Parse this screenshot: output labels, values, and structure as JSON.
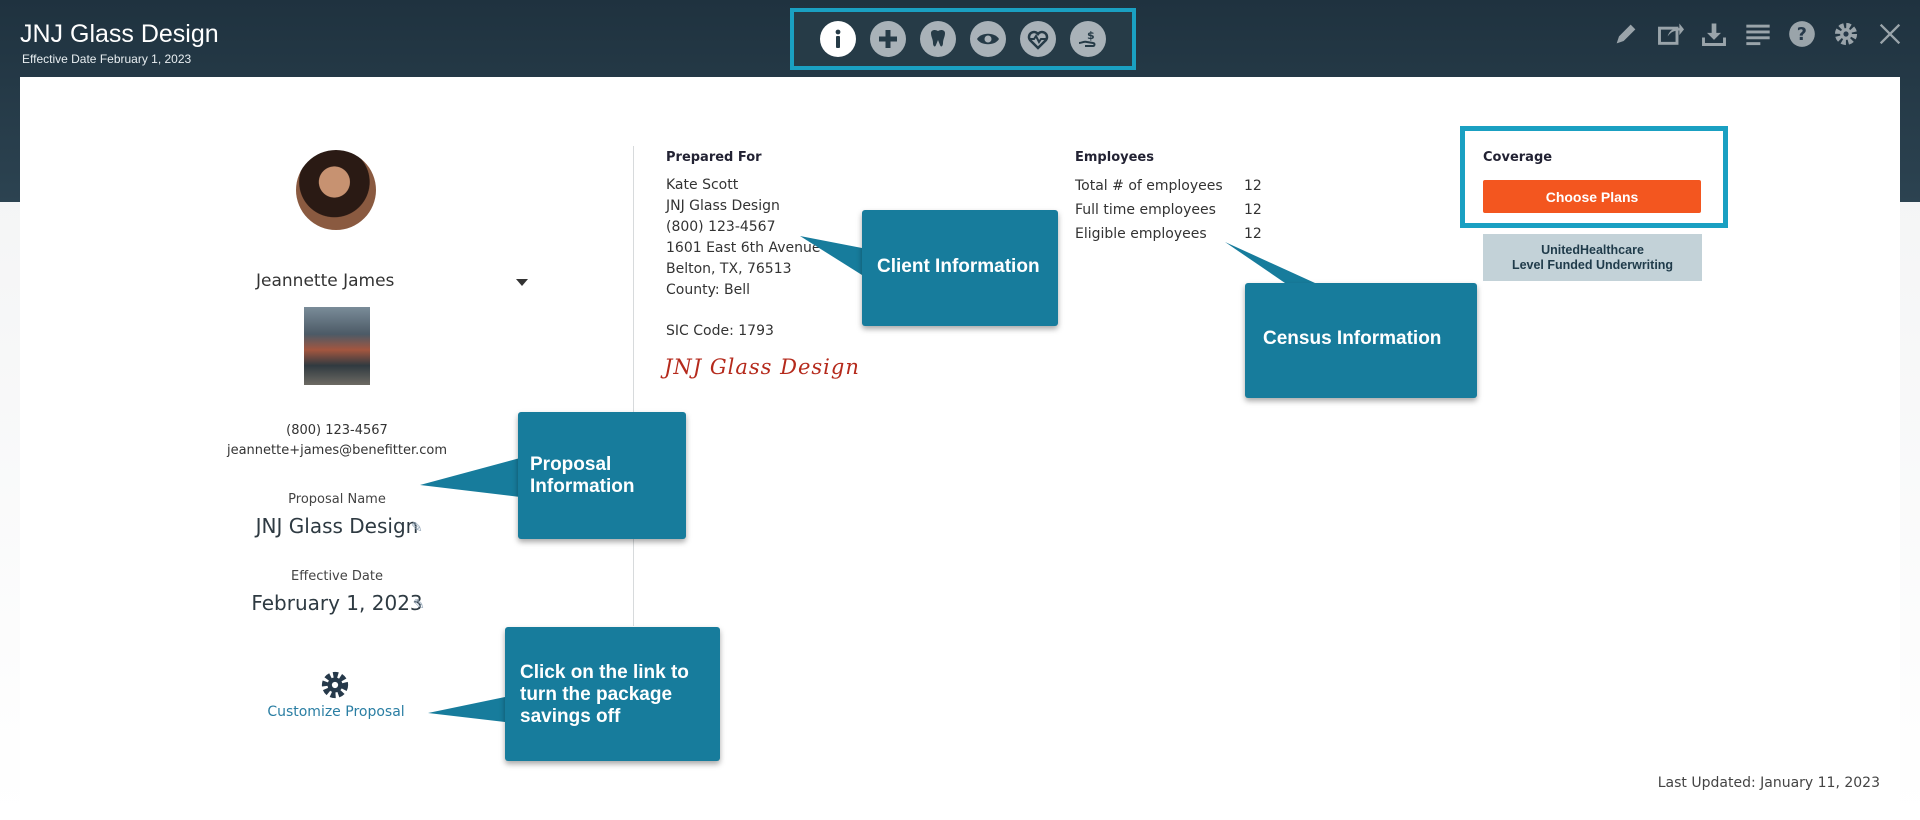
{
  "header": {
    "title": "JNJ Glass Design",
    "subtitle": "Effective Date February 1, 2023"
  },
  "nav_icons": [
    "info-icon",
    "plus-medical-icon",
    "tooth-icon",
    "eye-icon",
    "heartbeat-icon",
    "hand-dollar-icon"
  ],
  "toolbar_icons": [
    "pencil-icon",
    "share-icon",
    "download-icon",
    "list-icon",
    "help-icon",
    "gear-icon",
    "close-icon"
  ],
  "profile": {
    "name": "Jeannette James",
    "phone": "(800) 123-4567",
    "email": "jeannette+james@benefitter.com",
    "proposal_name_label": "Proposal Name",
    "proposal_name": "JNJ Glass Design",
    "effective_date_label": "Effective Date",
    "effective_date": "February 1, 2023",
    "customize_label": "Customize Proposal"
  },
  "prepared_for": {
    "title": "Prepared For",
    "contact": "Kate Scott",
    "company": "JNJ Glass Design",
    "phone": "(800) 123-4567",
    "address1": "1601 East 6th Avenue",
    "address2": "Belton, TX, 76513",
    "county": "County: Bell",
    "sic": "SIC Code: 1793",
    "logo_text": "JNJ Glass Design"
  },
  "employees": {
    "title": "Employees",
    "rows": [
      {
        "label": "Total # of employees",
        "value": "12"
      },
      {
        "label": "Full time employees",
        "value": "12"
      },
      {
        "label": "Eligible employees",
        "value": "12"
      }
    ]
  },
  "coverage": {
    "title": "Coverage",
    "button": "Choose Plans",
    "badge_line1": "UnitedHealthcare",
    "badge_line2": "Level Funded Underwriting"
  },
  "callouts": {
    "client": "Client Information",
    "census": "Census Information",
    "proposal": "Proposal Information",
    "customize": "Click on the link to turn the package savings off"
  },
  "footer": {
    "last_updated": "Last Updated: January 11, 2023"
  },
  "colors": {
    "header_bg": "#24394a",
    "highlight_border": "#1aa0c2",
    "callout_bg": "#177c9c",
    "choose_button": "#f3561f"
  }
}
